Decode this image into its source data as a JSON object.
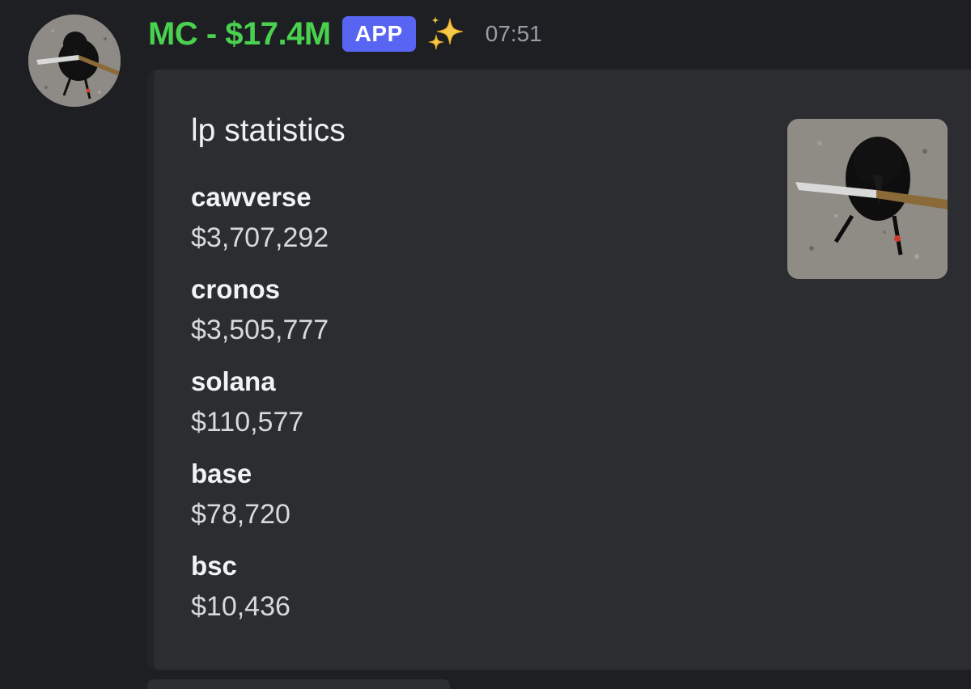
{
  "message": {
    "author": "MC - $17.4M",
    "badge": "APP",
    "emoji_icon": "sparkles-icon",
    "timestamp": "07:51",
    "avatar_icon": "crow-with-knife-avatar"
  },
  "embed": {
    "title": "lp statistics",
    "thumbnail_icon": "crow-with-knife-thumbnail",
    "fields": [
      {
        "name": "cawverse",
        "value": "$3,707,292"
      },
      {
        "name": "cronos",
        "value": "$3,505,777"
      },
      {
        "name": "solana",
        "value": "$110,577"
      },
      {
        "name": "base",
        "value": "$78,720"
      },
      {
        "name": "bsc",
        "value": "$10,436"
      }
    ]
  },
  "colors": {
    "background": "#1e1f22",
    "embed_background": "#2b2d31",
    "username": "#49d14f",
    "app_badge": "#5865f2",
    "timestamp": "#9a9ca3"
  }
}
